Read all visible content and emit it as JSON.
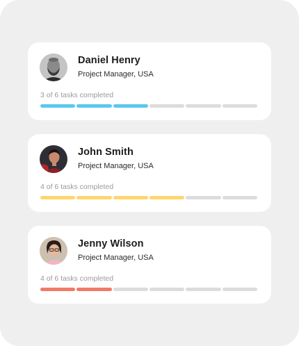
{
  "cards": [
    {
      "name": "Daniel Henry",
      "role": "Project Manager, USA",
      "progress_text": "3 of 6 tasks completed",
      "completed": 3,
      "total": 6,
      "color": "#5bc8ef"
    },
    {
      "name": "John Smith",
      "role": "Project Manager, USA",
      "progress_text": "4 of 6 tasks completed",
      "completed": 4,
      "total": 6,
      "color": "#ffd66e"
    },
    {
      "name": "Jenny Wilson",
      "role": "Project Manager, USA",
      "progress_text": "4 of 6 tasks completed",
      "completed": 2,
      "total": 6,
      "color": "#f07a68"
    }
  ],
  "colors": {
    "track": "#dcdcdc",
    "background": "#efefef",
    "card": "#ffffff"
  }
}
